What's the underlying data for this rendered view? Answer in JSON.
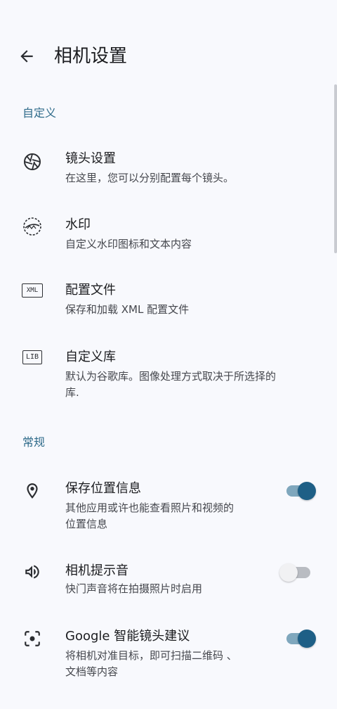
{
  "header": {
    "title": "相机设置"
  },
  "sections": {
    "custom": "自定义",
    "general": "常规"
  },
  "items": {
    "lens": {
      "title": "镜头设置",
      "subtitle": "在这里，您可以分别配置每个镜头。"
    },
    "watermark": {
      "title": "水印",
      "subtitle": "自定义水印图标和文本内容"
    },
    "config": {
      "title": "配置文件",
      "subtitle": "保存和加载 XML 配置文件"
    },
    "library": {
      "title": "自定义库",
      "subtitle_line1": "默认为谷歌库。图像处理方式取决于所选择的",
      "subtitle_line2": "库."
    },
    "location": {
      "title": "保存位置信息",
      "subtitle_line1": "其他应用或许也能查看照片和视频的",
      "subtitle_line2": "位置信息",
      "enabled": true
    },
    "sound": {
      "title": "相机提示音",
      "subtitle": "快门声音将在拍摄照片时启用",
      "enabled": false
    },
    "lens_suggest": {
      "title": "Google 智能镜头建议",
      "subtitle_line1": "将相机对准目标，即可扫描二维码 、",
      "subtitle_line2": "文档等内容",
      "enabled": true
    }
  },
  "icons": {
    "back": "arrow-back-icon",
    "lens": "camera-aperture-icon",
    "watermark": "watermark-icon",
    "config": "xml-file-icon",
    "library": "lib-icon",
    "location": "location-pin-icon",
    "sound": "speaker-icon",
    "lens_suggest": "lens-scan-icon"
  },
  "badges": {
    "xml": "XML",
    "lib": "LIB"
  },
  "colors": {
    "background": "#f8f9fd",
    "section": "#2f6b8a",
    "toggle_on": "#1e5f86",
    "toggle_on_track": "#7fa7bd"
  }
}
